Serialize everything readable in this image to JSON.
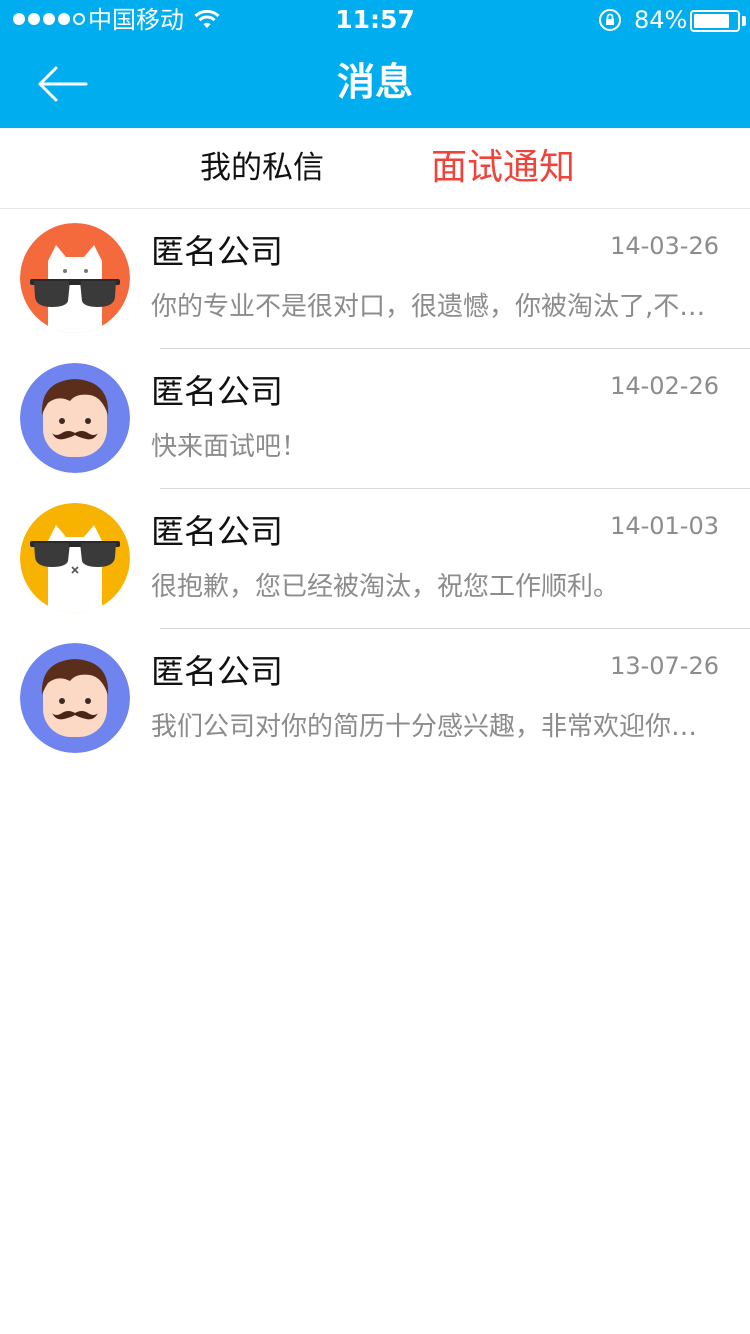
{
  "status_bar": {
    "carrier": "中国移动",
    "time": "11:57",
    "battery_percent": "84%",
    "battery_level": 0.84,
    "signal_bars_filled": 4,
    "signal_bars_total": 5
  },
  "header": {
    "title": "消息",
    "background_color": "#00aeef"
  },
  "tabs": [
    {
      "label": "我的私信",
      "active": false
    },
    {
      "label": "面试通知",
      "active": true,
      "color": "#f0433a"
    }
  ],
  "messages": [
    {
      "company": "匿名公司",
      "date": "14-03-26",
      "preview": "你的专业不是很对口，很遗憾，你被淘汰了,不要灰心",
      "avatar": "white-cat-sunglasses-avatar",
      "avatar_color": "#f56a3d"
    },
    {
      "company": "匿名公司",
      "date": "14-02-26",
      "preview": "快来面试吧！",
      "avatar": "mustache-man-avatar",
      "avatar_color": "#6f84ef"
    },
    {
      "company": "匿名公司",
      "date": "14-01-03",
      "preview": "很抱歉，您已经被淘汰，祝您工作顺利。",
      "avatar": "white-cat-sunglasses-avatar",
      "avatar_color": "#f8b300"
    },
    {
      "company": "匿名公司",
      "date": "13-07-26",
      "preview": "我们公司对你的简历十分感兴趣，非常欢迎你来面试",
      "avatar": "mustache-man-avatar",
      "avatar_color": "#6f84ef"
    }
  ]
}
